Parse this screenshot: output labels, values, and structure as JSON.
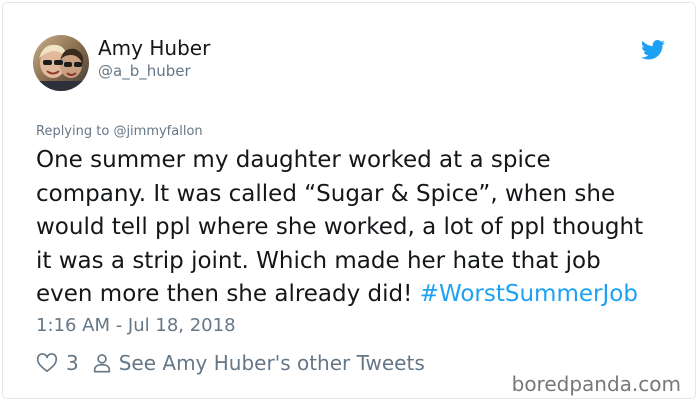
{
  "tweet": {
    "author_name": "Amy Huber",
    "author_handle": "@a_b_huber",
    "replying_prefix": "Replying to ",
    "replying_handle": "@jimmyfallon",
    "body_lines": [
      "One summer my daughter worked at a spice",
      "company. It was called “Sugar & Spice”, when she",
      "would tell ppl where she worked, a lot of ppl thought",
      "it was a strip joint. Which made her hate that job",
      "even more then she already did! "
    ],
    "hashtag": "#WorstSummerJob",
    "timestamp": "1:16 AM - Jul 18, 2018",
    "like_count": "3",
    "other_tweets_link": "See Amy Huber's other Tweets"
  },
  "icons": {
    "brand": "twitter-bird-icon",
    "like": "heart-icon",
    "profile": "person-icon"
  },
  "colors": {
    "twitter_blue": "#1da1f2",
    "secondary_text": "#657786",
    "primary_text": "#14171a",
    "border": "#e1e8ed"
  },
  "watermark": "boredpanda.com"
}
